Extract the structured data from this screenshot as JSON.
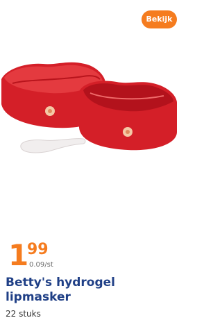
{
  "card": {
    "action_label": "Bekijk",
    "price": {
      "euros": "1",
      "cents": "99",
      "unit": "0.09/st"
    },
    "product_title": "Betty's hydrogel lipmasker",
    "quantity": "22 stuks"
  },
  "colors": {
    "accent": "#f57c1f",
    "title": "#1f3f86",
    "product_red": "#e2262d"
  }
}
